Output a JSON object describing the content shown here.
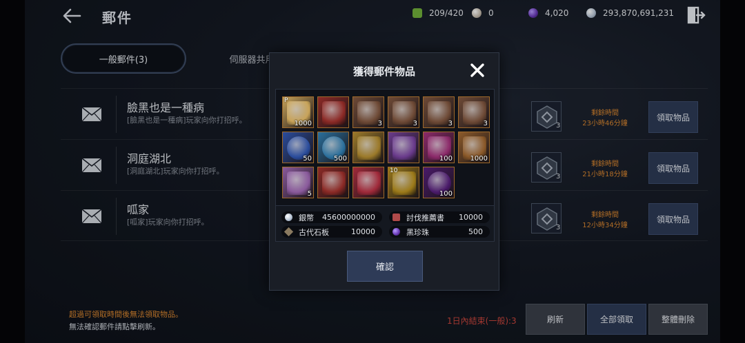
{
  "header": {
    "title": "郵件",
    "resources": [
      {
        "icon": "stamina-icon",
        "value": "209/420",
        "color": "#6fae3a"
      },
      {
        "icon": "pearl-icon",
        "value": "0",
        "color": "#c8bfb2"
      },
      {
        "icon": "black-pearl-icon",
        "value": "4,020",
        "color": "#6a3bb8"
      },
      {
        "icon": "silver-coin-icon",
        "value": "293,870,691,231",
        "color": "#b9c6d6"
      }
    ]
  },
  "tabs": [
    {
      "label": "一般郵件(3)",
      "active": true
    },
    {
      "label": "伺服器共用郵件",
      "active": false
    }
  ],
  "mails": [
    {
      "sender": "臉黑也是一種病",
      "message": "[臉黑也是一種病]玩家向你打招呼。",
      "attach_count": "3",
      "remain_label": "剩餘時間",
      "remain_time": "23小時46分鐘",
      "claim_label": "領取物品"
    },
    {
      "sender": "洞庭湖北",
      "message": "[洞庭湖北]玩家向你打招呼。",
      "attach_count": "3",
      "remain_label": "剩餘時間",
      "remain_time": "21小時18分鐘",
      "claim_label": "領取物品"
    },
    {
      "sender": "呱家",
      "message": "[呱家]玩家向你打招呼。",
      "attach_count": "3",
      "remain_label": "剩餘時間",
      "remain_time": "12小時34分鐘",
      "claim_label": "領取物品"
    }
  ],
  "footer": {
    "note1": "超過可領取時間後無法領取物品。",
    "note2": "無法確認郵件請點擊刷新。",
    "daily_status": "1日內結束(一般):3",
    "refresh_label": "刷新",
    "claim_all_label": "全部領取",
    "delete_all_label": "整體刪除"
  },
  "modal": {
    "title": "獲得郵件物品",
    "confirm_label": "確認",
    "items": [
      {
        "icon": "scroll-icon",
        "qty": "1000",
        "corner": "P",
        "color": "#c9a45a"
      },
      {
        "icon": "treasure-chest-red-icon",
        "qty": "",
        "corner": "",
        "color": "#8c2a26"
      },
      {
        "icon": "helmet-armor-icon",
        "qty": "3",
        "corner": "",
        "color": "#6e4a36"
      },
      {
        "icon": "ram-helmet-armor-icon",
        "qty": "3",
        "corner": "",
        "color": "#6e4a36"
      },
      {
        "icon": "lion-helmet-armor-icon",
        "qty": "3",
        "corner": "",
        "color": "#6e4a36"
      },
      {
        "icon": "horned-helmet-armor-icon",
        "qty": "3",
        "corner": "",
        "color": "#6e4a36"
      },
      {
        "icon": "blue-orb-icon",
        "qty": "50",
        "corner": "",
        "color": "#2a4c9c"
      },
      {
        "icon": "cyan-orb-icon",
        "qty": "500",
        "corner": "",
        "color": "#2a6f9c"
      },
      {
        "icon": "golden-chest-icon",
        "qty": "",
        "corner": "",
        "color": "#9c7a2a"
      },
      {
        "icon": "crystal-shard-icon",
        "qty": "",
        "corner": "",
        "color": "#6a3b8c"
      },
      {
        "icon": "gold-ore-icon",
        "qty": "100",
        "corner": "",
        "color": "#8c2a6a"
      },
      {
        "icon": "ornate-chest-icon",
        "qty": "1000",
        "corner": "",
        "color": "#8c5a2a"
      },
      {
        "icon": "map-scroll-icon",
        "qty": "5",
        "corner": "",
        "color": "#8a5a9c"
      },
      {
        "icon": "red-chest-icon",
        "qty": "",
        "corner": "",
        "color": "#8c2a26"
      },
      {
        "icon": "gift-box-icon",
        "qty": "",
        "corner": "",
        "color": "#a02a3a"
      },
      {
        "icon": "gold-card-icon",
        "qty": "",
        "corner": "10",
        "color": "#9c7a1a"
      },
      {
        "icon": "purple-ring-icon",
        "qty": "100",
        "corner": "",
        "color": "#4a1a6a"
      }
    ],
    "summary": [
      {
        "icon": "silver-coin-icon",
        "name": "銀幣",
        "value": "45600000000",
        "color": "#b9c6d6"
      },
      {
        "icon": "quest-book-icon",
        "name": "討伐推薦書",
        "value": "10000",
        "color": "#b04a4a"
      },
      {
        "icon": "stone-tablet-icon",
        "name": "古代石板",
        "value": "10000",
        "color": "#8a7a60"
      },
      {
        "icon": "black-pearl-icon",
        "name": "黑珍珠",
        "value": "500",
        "color": "#6a3bb8"
      }
    ]
  }
}
